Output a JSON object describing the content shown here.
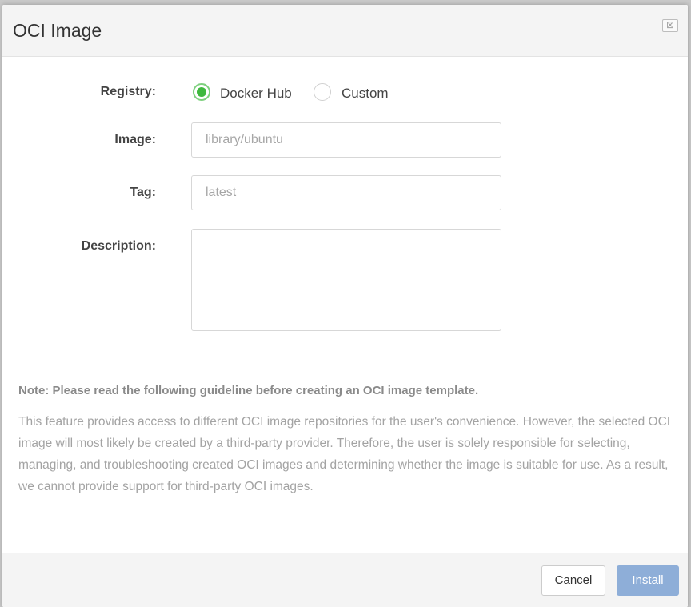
{
  "dialog": {
    "title": "OCI Image",
    "close_icon": "close-icon",
    "close_glyph": "⊠"
  },
  "form": {
    "registry_label": "Registry:",
    "registry_options": [
      {
        "label": "Docker Hub",
        "checked": true
      },
      {
        "label": "Custom",
        "checked": false
      }
    ],
    "image_label": "Image:",
    "image_value": "",
    "image_placeholder": "library/ubuntu",
    "tag_label": "Tag:",
    "tag_value": "",
    "tag_placeholder": "latest",
    "description_label": "Description:",
    "description_value": ""
  },
  "note": {
    "title": "Note: Please read the following guideline before creating an OCI image template.",
    "body": "This feature provides access to different OCI image repositories for the user's convenience. However, the selected OCI image will most likely be created by a third-party provider. Therefore, the user is solely responsible for selecting, managing, and troubleshooting created OCI images and determining whether the image is suitable for use. As a result, we cannot provide support for third-party OCI images."
  },
  "footer": {
    "cancel_label": "Cancel",
    "install_label": "Install"
  },
  "colors": {
    "radio_selected": "#3fb83f",
    "primary_button_disabled": "#8eaed8"
  }
}
